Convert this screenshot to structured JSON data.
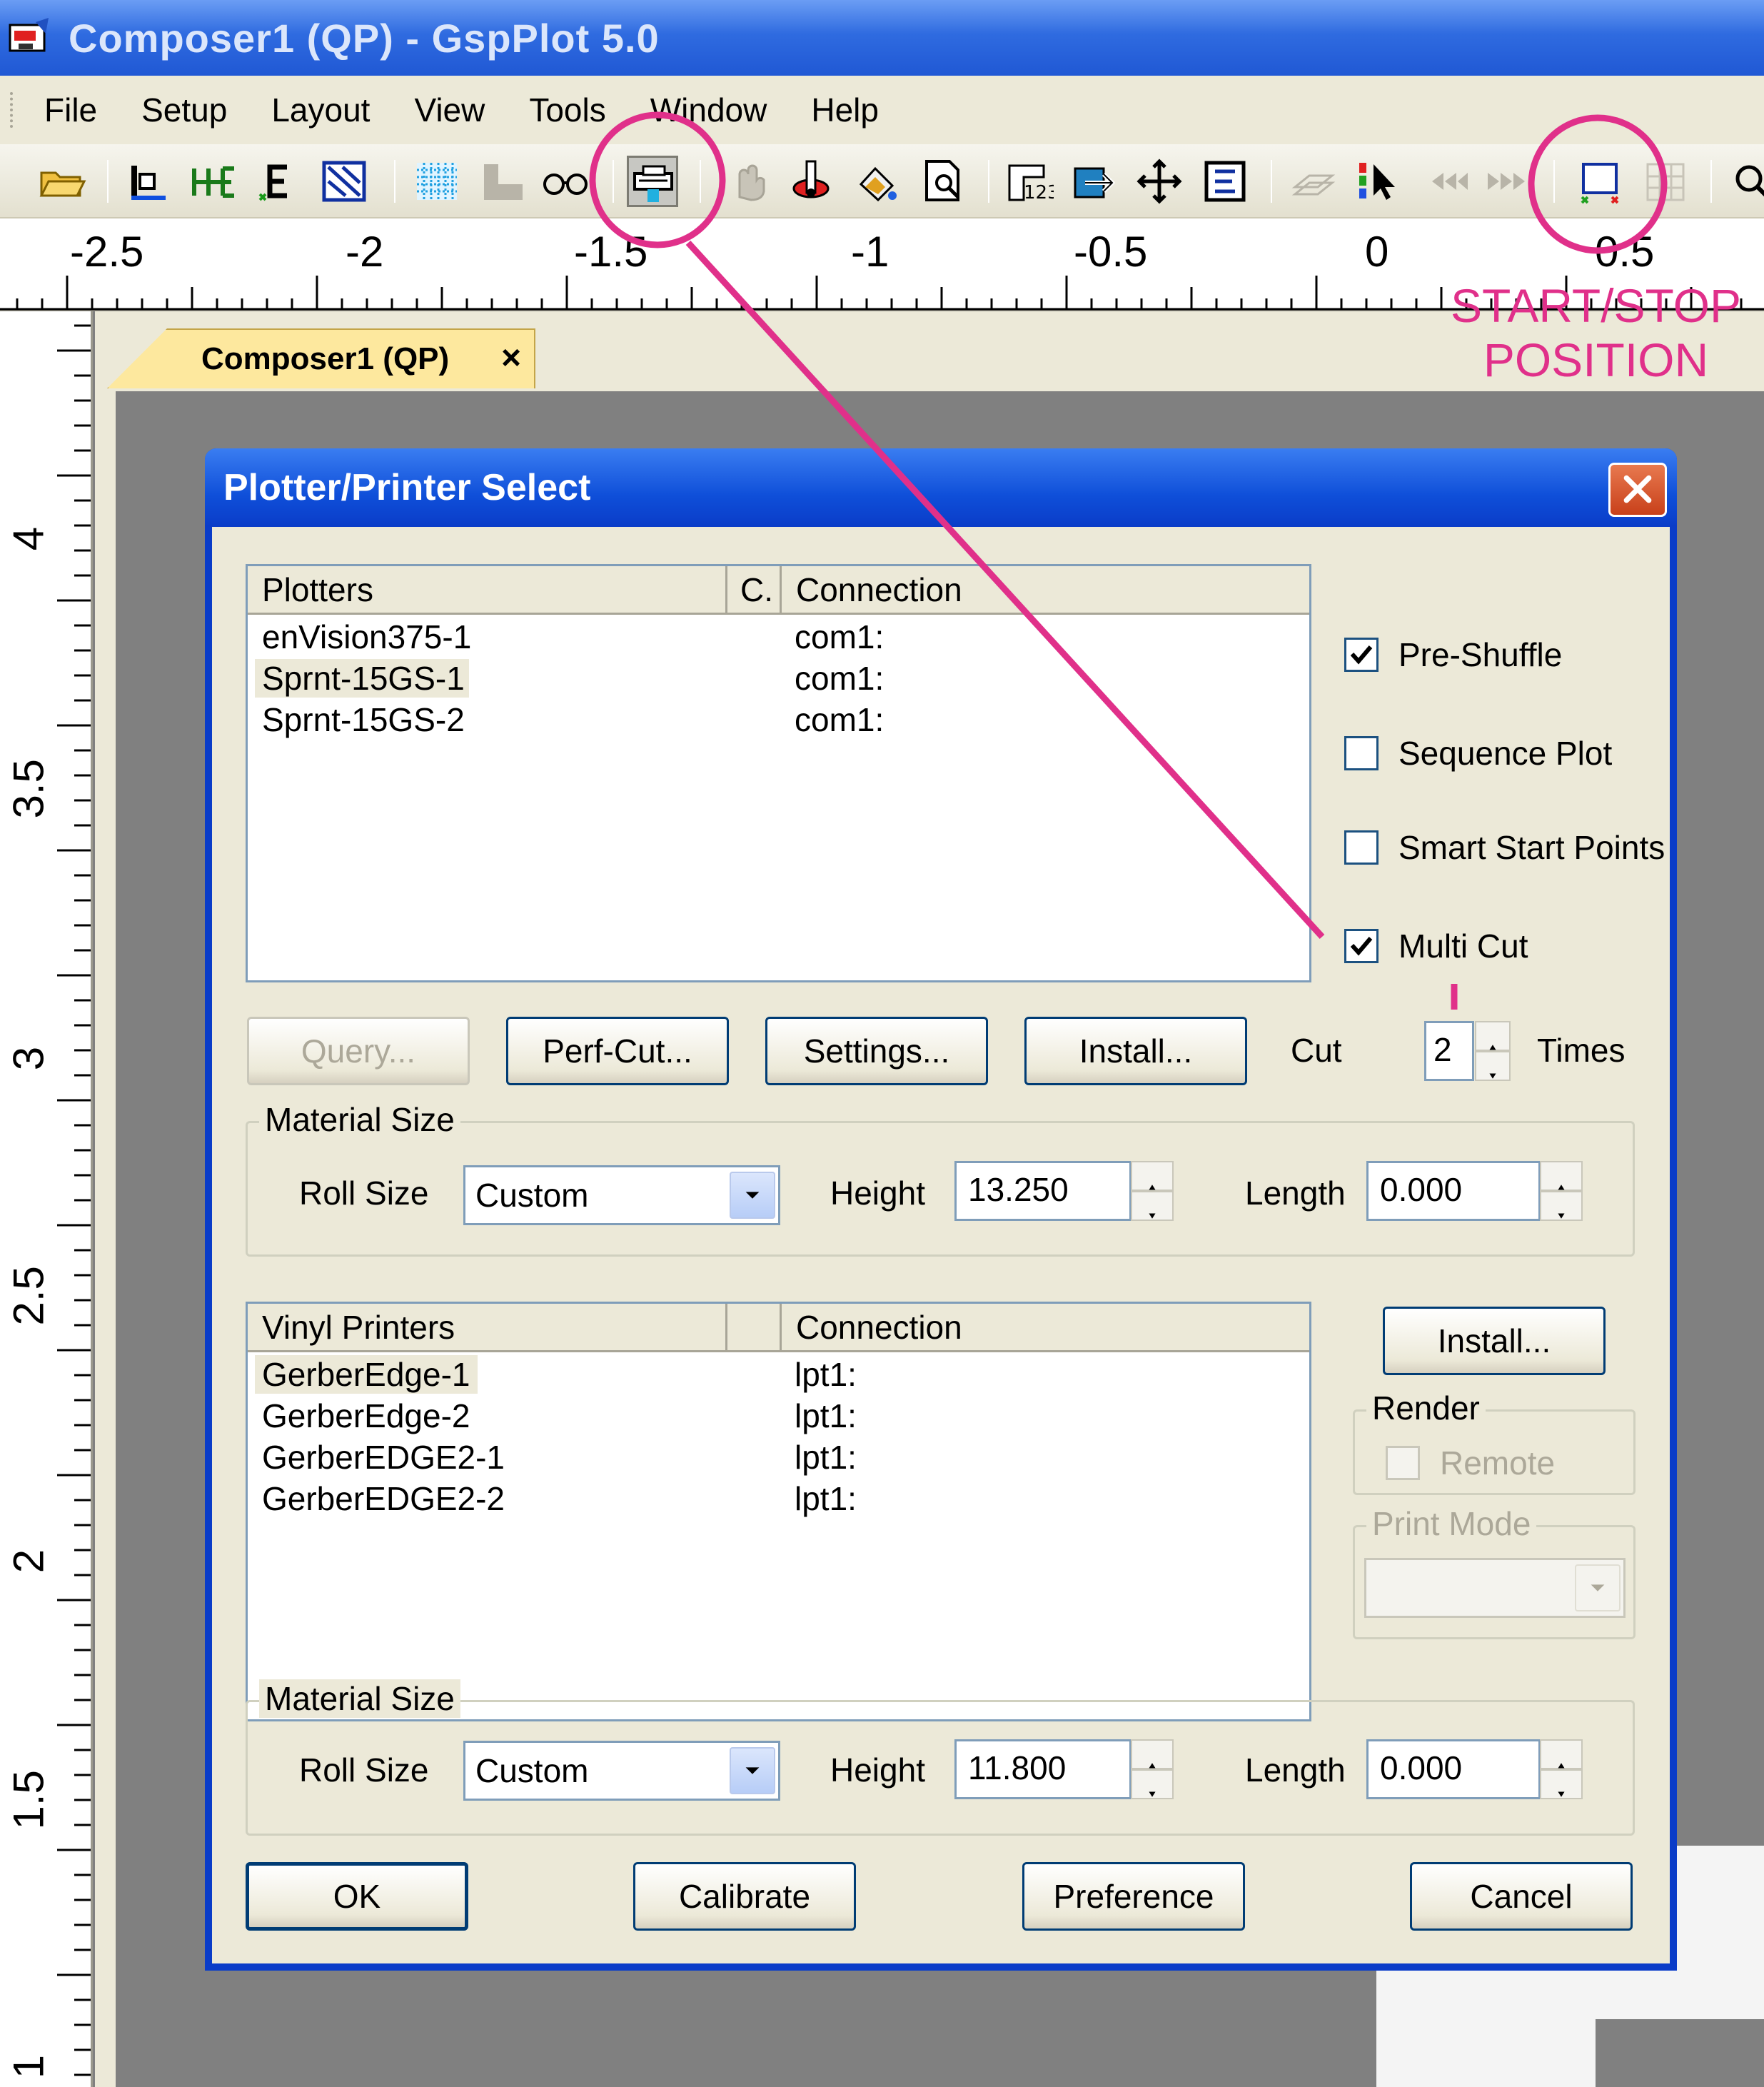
{
  "window": {
    "title": "Composer1 (QP) - GspPlot 5.0"
  },
  "menu": [
    "File",
    "Setup",
    "Layout",
    "View",
    "Tools",
    "Window",
    "Help"
  ],
  "toolbar_icons": [
    "open-folder-icon",
    "align-icon",
    "position-icon",
    "e-icon",
    "fill-icon",
    "grid-icon",
    "shadow-icon",
    "glasses-icon",
    "plotter-select-icon",
    "hand-icon",
    "pen-icon",
    "color-icon",
    "preview-icon",
    "number-icon",
    "export-icon",
    "move-icon",
    "edit-icon",
    "layers-icon",
    "select-icon",
    "rewind-icon",
    "forward-icon",
    "start-stop-position-icon",
    "grid-disabled-icon",
    "zoom-icon"
  ],
  "ruler": {
    "h_labels": [
      "-2.5",
      "-2",
      "-1.5",
      "-1",
      "-0.5",
      "0",
      "0.5"
    ],
    "v_labels": [
      "4",
      "3.5",
      "3",
      "2.5",
      "2",
      "1.5",
      "1"
    ]
  },
  "doc_tab": {
    "label": "Composer1 (QP)",
    "close": "×"
  },
  "dialog": {
    "title": "Plotter/Printer Select",
    "plotters": {
      "columns": [
        "Plotters",
        "C.",
        "Connection"
      ],
      "rows": [
        {
          "name": "enVision375-1",
          "connection": "com1:"
        },
        {
          "name": "Sprnt-15GS-1",
          "connection": "com1:"
        },
        {
          "name": "Sprnt-15GS-2",
          "connection": "com1:"
        }
      ]
    },
    "options": {
      "pre_shuffle": {
        "label": "Pre-Shuffle",
        "checked": true
      },
      "sequence_plot": {
        "label": "Sequence Plot",
        "checked": false
      },
      "smart_start": {
        "label": "Smart Start Points",
        "checked": false
      },
      "multi_cut": {
        "label": "Multi Cut",
        "checked": true
      }
    },
    "buttons_row1": {
      "query": "Query...",
      "perf_cut": "Perf-Cut...",
      "settings": "Settings...",
      "install": "Install..."
    },
    "cut": {
      "label": "Cut",
      "value": "2",
      "times": "Times"
    },
    "material1": {
      "title": "Material Size",
      "roll_label": "Roll Size",
      "roll_value": "Custom",
      "height_label": "Height",
      "height_value": "13.250",
      "length_label": "Length",
      "length_value": "0.000"
    },
    "vinyl": {
      "columns": [
        "Vinyl Printers",
        "",
        "Connection"
      ],
      "rows": [
        {
          "name": "GerberEdge-1",
          "connection": "lpt1:"
        },
        {
          "name": "GerberEdge-2",
          "connection": "lpt1:"
        },
        {
          "name": "GerberEDGE2-1",
          "connection": "lpt1:"
        },
        {
          "name": "GerberEDGE2-2",
          "connection": "lpt1:"
        }
      ]
    },
    "vinyl_install": "Install...",
    "render": {
      "title": "Render",
      "remote": "Remote"
    },
    "print_mode": {
      "title": "Print Mode"
    },
    "material2": {
      "title": "Material Size",
      "roll_label": "Roll Size",
      "roll_value": "Custom",
      "height_label": "Height",
      "height_value": "11.800",
      "length_label": "Length",
      "length_value": "0.000"
    },
    "bottom_buttons": {
      "ok": "OK",
      "calibrate": "Calibrate",
      "preference": "Preference",
      "cancel": "Cancel"
    }
  },
  "annotation": {
    "line1": "START/STOP",
    "line2": "POSITION",
    "color": "#e0308a"
  }
}
